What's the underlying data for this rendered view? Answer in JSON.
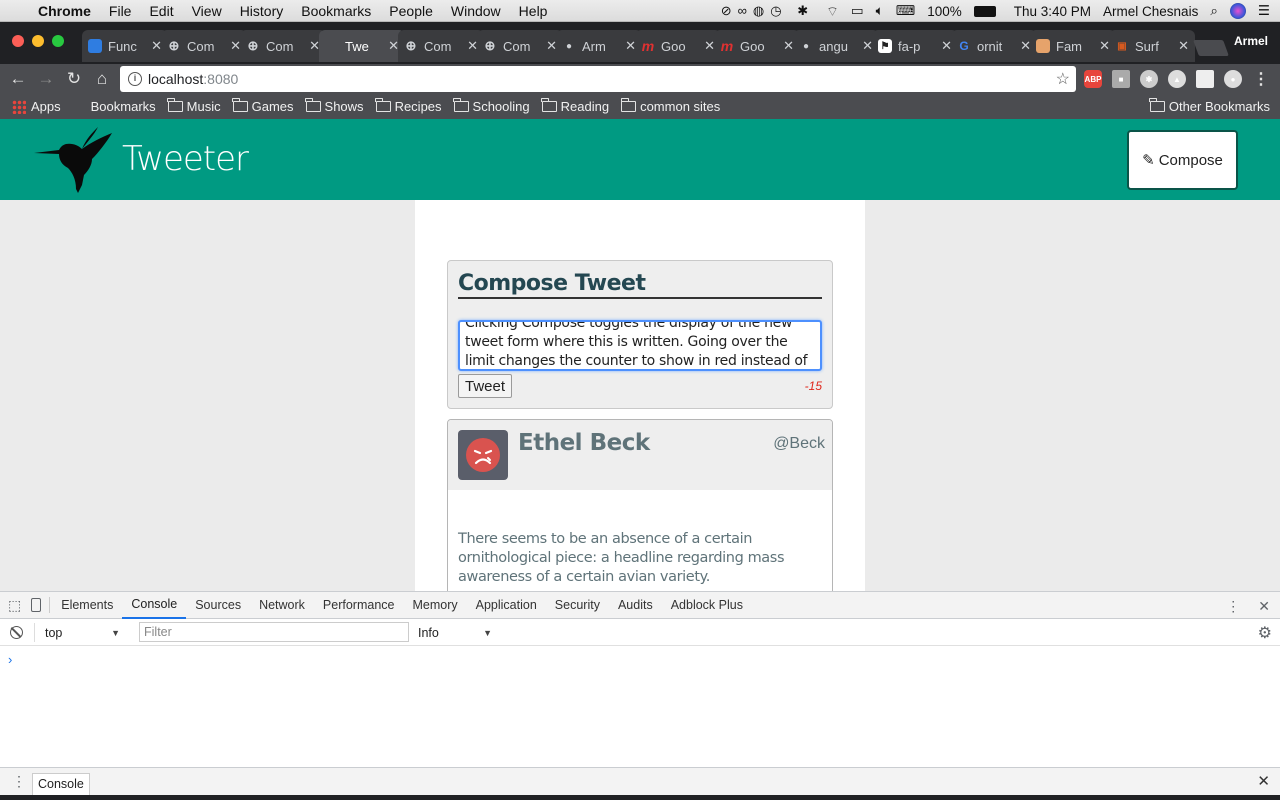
{
  "menubar": {
    "app": "Chrome",
    "items": [
      "File",
      "Edit",
      "View",
      "History",
      "Bookmarks",
      "People",
      "Window",
      "Help"
    ],
    "battery": "100%",
    "clock": "Thu 3:40 PM",
    "user": "Armel Chesnais"
  },
  "tabs": [
    {
      "title": "Func",
      "fav": "#2f7de1",
      "active": false
    },
    {
      "title": "Com",
      "fav": "globe",
      "active": false
    },
    {
      "title": "Com",
      "fav": "globe",
      "active": false
    },
    {
      "title": "Twe",
      "fav": "none",
      "active": true
    },
    {
      "title": "Com",
      "fav": "globe",
      "active": false
    },
    {
      "title": "Com",
      "fav": "globe",
      "active": false
    },
    {
      "title": "Arm",
      "fav": "github",
      "active": false
    },
    {
      "title": "Goo",
      "fav": "m",
      "active": false
    },
    {
      "title": "Goo",
      "fav": "m",
      "active": false
    },
    {
      "title": "angu",
      "fav": "github",
      "active": false
    },
    {
      "title": "fa-p",
      "fav": "flag",
      "active": false
    },
    {
      "title": "ornit",
      "fav": "google",
      "active": false
    },
    {
      "title": "Fam",
      "fav": "#e6a36b",
      "active": false
    },
    {
      "title": "Surf",
      "fav": "tv",
      "active": false
    }
  ],
  "profile_name": "Armel",
  "address": {
    "host": "localhost",
    "port": ":8080"
  },
  "bookmarks": {
    "apps": "Apps",
    "items": [
      "Bookmarks",
      "Music",
      "Games",
      "Shows",
      "Recipes",
      "Schooling",
      "Reading",
      "common sites"
    ],
    "other": "Other Bookmarks"
  },
  "app": {
    "brand": "Tweeter",
    "compose_label": "Compose",
    "compose_title": "Compose Tweet",
    "draft_text": "Clicking Compose toggles the display of the new tweet form where this is written. Going over the limit changes the counter to show in red instead of black.",
    "tweet_button": "Tweet",
    "counter": "-15",
    "counter_color": "#e0261b",
    "accent": "#009a82",
    "tweet": {
      "name": "Ethel Beck",
      "handle": "@Beck",
      "text": "There seems to be an absence of a certain ornithological piece: a headline regarding mass awareness of a certain avian variety."
    }
  },
  "devtools": {
    "tabs": [
      "Elements",
      "Console",
      "Sources",
      "Network",
      "Performance",
      "Memory",
      "Application",
      "Security",
      "Audits",
      "Adblock Plus"
    ],
    "active_tab": "Console",
    "context": "top",
    "filter_placeholder": "Filter",
    "level": "Info",
    "prompt": "›",
    "drawer_tab": "Console"
  }
}
